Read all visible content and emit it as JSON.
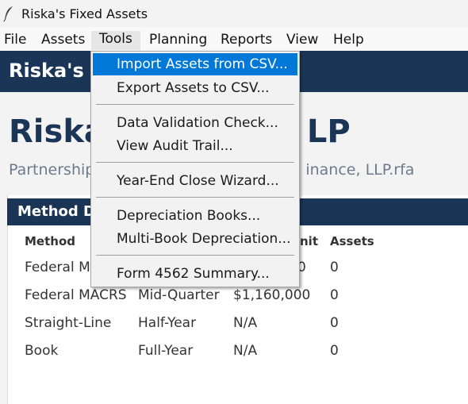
{
  "window": {
    "title": "Riska's Fixed Assets"
  },
  "menubar": {
    "items": [
      "File",
      "Assets",
      "Tools",
      "Planning",
      "Reports",
      "View",
      "Help"
    ]
  },
  "appbar": {
    "title": "Riska's F"
  },
  "page": {
    "title_visible": "Riska",
    "title_tail": "LP",
    "subtitle_left": "Partnership",
    "subtitle_right": "inance, LLP.rfa"
  },
  "card": {
    "header": "Method D",
    "columns": [
      "Method",
      "nit",
      "Assets"
    ],
    "rows": [
      {
        "method": "Federal MA",
        "convention": "",
        "limit": "0",
        "assets": "0"
      },
      {
        "method": "Federal MACRS",
        "convention": "Mid-Quarter",
        "limit": "$1,160,000",
        "assets": "0"
      },
      {
        "method": "Straight-Line",
        "convention": "Half-Year",
        "limit": "N/A",
        "assets": "0"
      },
      {
        "method": "Book",
        "convention": "Full-Year",
        "limit": "N/A",
        "assets": "0"
      }
    ]
  },
  "tools_menu": {
    "items": [
      "Import Assets from CSV...",
      "Export Assets to CSV...",
      "Data Validation Check...",
      "View Audit Trail...",
      "Year-End Close Wizard...",
      "Depreciation Books...",
      "Multi-Book Depreciation...",
      "Form 4562 Summary..."
    ],
    "highlight_color": "#0078d7"
  },
  "colors": {
    "navy": "#1b3557",
    "accent": "#0078d7"
  }
}
